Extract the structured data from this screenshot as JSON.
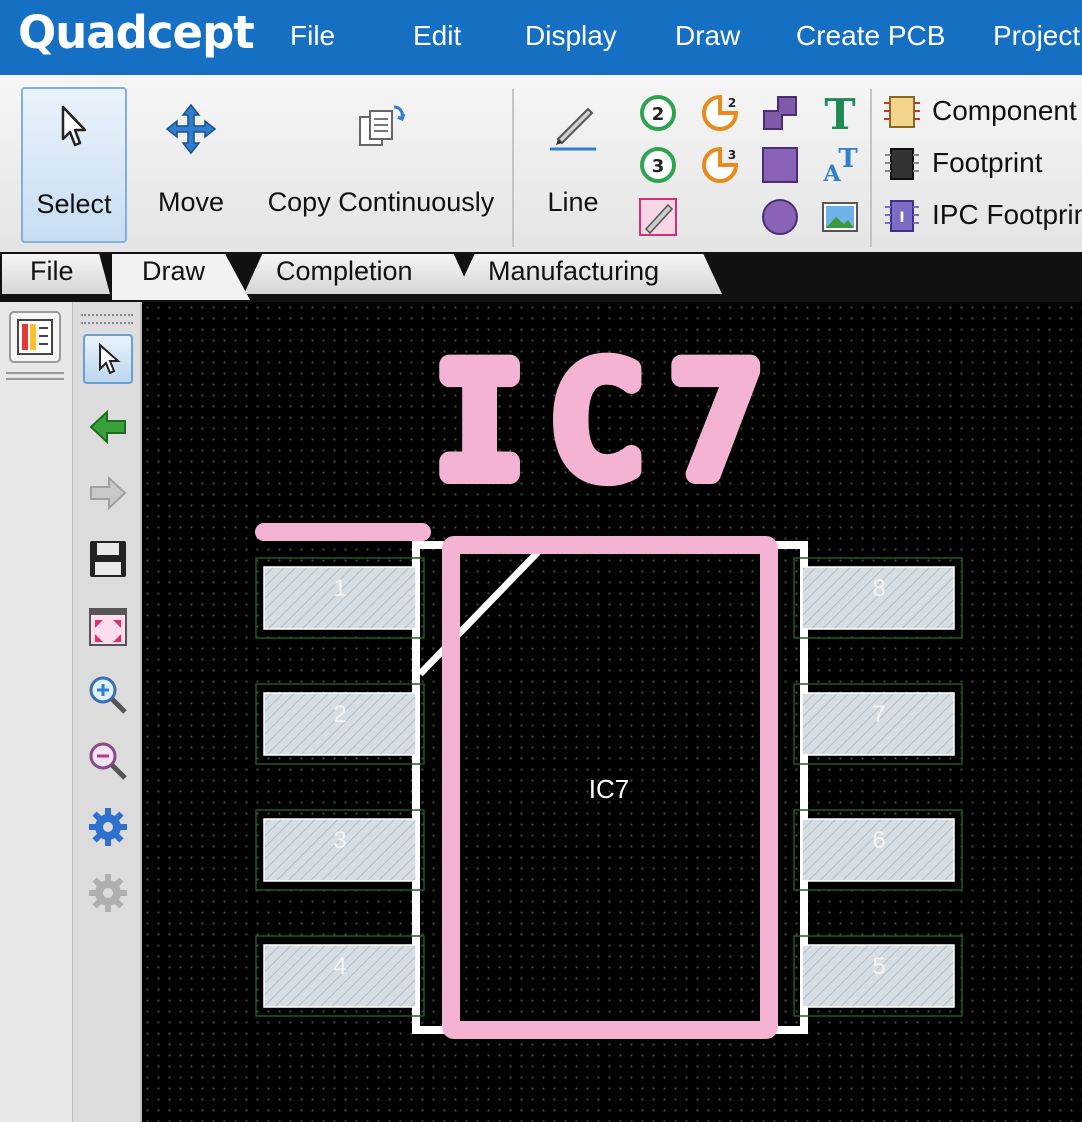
{
  "app": {
    "logo": "Quadcept"
  },
  "menu": [
    "File",
    "Edit",
    "Display",
    "Draw",
    "Create PCB",
    "Project"
  ],
  "ribbon": {
    "select_label": "Select",
    "move_label": "Move",
    "copy_label": "Copy Continuously",
    "line_label": "Line",
    "component_label": "Component",
    "footprint_label": "Footprint",
    "ipc_label": "IPC Footprin"
  },
  "tabs": [
    "File",
    "Draw",
    "Completion",
    "Manufacturing"
  ],
  "active_tab": "Draw",
  "footprint": {
    "title": "IC7",
    "body_label": "IC7",
    "pads_left": [
      "1",
      "2",
      "3",
      "4"
    ],
    "pads_right": [
      "8",
      "7",
      "6",
      "5"
    ]
  },
  "colors": {
    "accent": "#1570c4",
    "silk": "#f5b3d4",
    "outline": "#ffffff",
    "pad_fill": "#d6dde3",
    "canvas_bg": "#000000"
  }
}
